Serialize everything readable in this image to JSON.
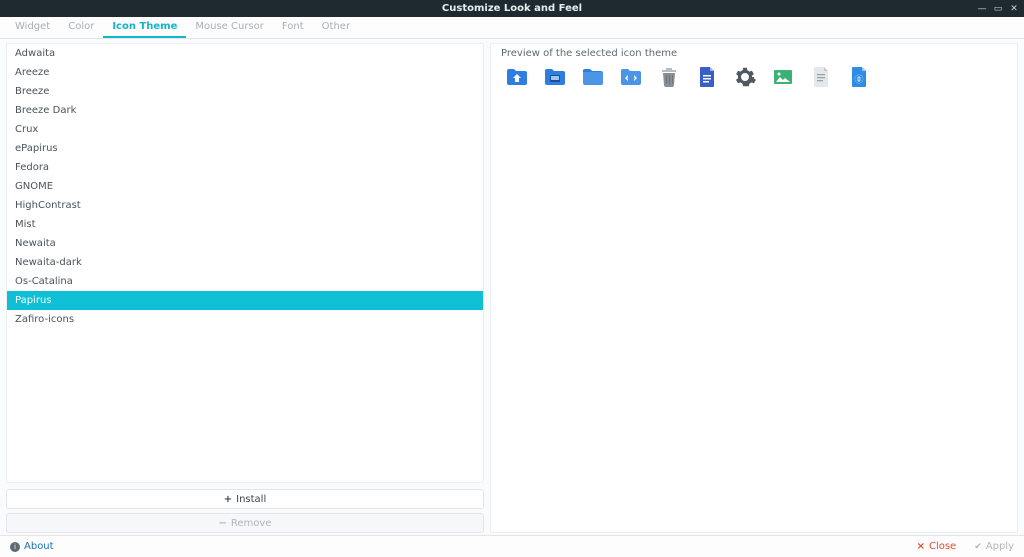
{
  "window": {
    "title": "Customize Look and Feel",
    "minimize_glyph": "—",
    "restore_glyph": "▭",
    "close_glyph": "✕"
  },
  "tabs": {
    "items": [
      {
        "label": "Widget"
      },
      {
        "label": "Color"
      },
      {
        "label": "Icon Theme"
      },
      {
        "label": "Mouse Cursor"
      },
      {
        "label": "Font"
      },
      {
        "label": "Other"
      }
    ],
    "active_index": 2
  },
  "theme_list": {
    "items": [
      {
        "name": "Adwaita"
      },
      {
        "name": "Areeze"
      },
      {
        "name": "Breeze"
      },
      {
        "name": "Breeze Dark"
      },
      {
        "name": "Crux"
      },
      {
        "name": "ePapirus"
      },
      {
        "name": "Fedora"
      },
      {
        "name": "GNOME"
      },
      {
        "name": "HighContrast"
      },
      {
        "name": "Mist"
      },
      {
        "name": "Newaita"
      },
      {
        "name": "Newaita-dark"
      },
      {
        "name": "Os-Catalina"
      },
      {
        "name": "Papirus"
      },
      {
        "name": "Zafiro-icons"
      }
    ],
    "selected_index": 13
  },
  "actions": {
    "install_label": "Install",
    "install_glyph": "+",
    "remove_label": "Remove",
    "remove_glyph": "−",
    "remove_enabled": false
  },
  "preview": {
    "label": "Preview of the selected icon theme",
    "icons": [
      {
        "semantic": "home-folder",
        "color": "#2f7de1"
      },
      {
        "semantic": "desktop-folder",
        "color": "#2f7de1"
      },
      {
        "semantic": "folder",
        "color": "#4a95e6"
      },
      {
        "semantic": "code-folder",
        "color": "#4a95e6"
      },
      {
        "semantic": "trash",
        "color": "#8a8f93"
      },
      {
        "semantic": "document",
        "color": "#3a5fc4"
      },
      {
        "semantic": "settings-gear",
        "color": "#4e5963"
      },
      {
        "semantic": "image",
        "color": "#3bb273"
      },
      {
        "semantic": "text-file",
        "color": "#c1c7cc"
      },
      {
        "semantic": "web-file",
        "color": "#2f8de6"
      }
    ]
  },
  "status": {
    "about_label": "About",
    "close_label": "Close",
    "apply_label": "Apply"
  }
}
